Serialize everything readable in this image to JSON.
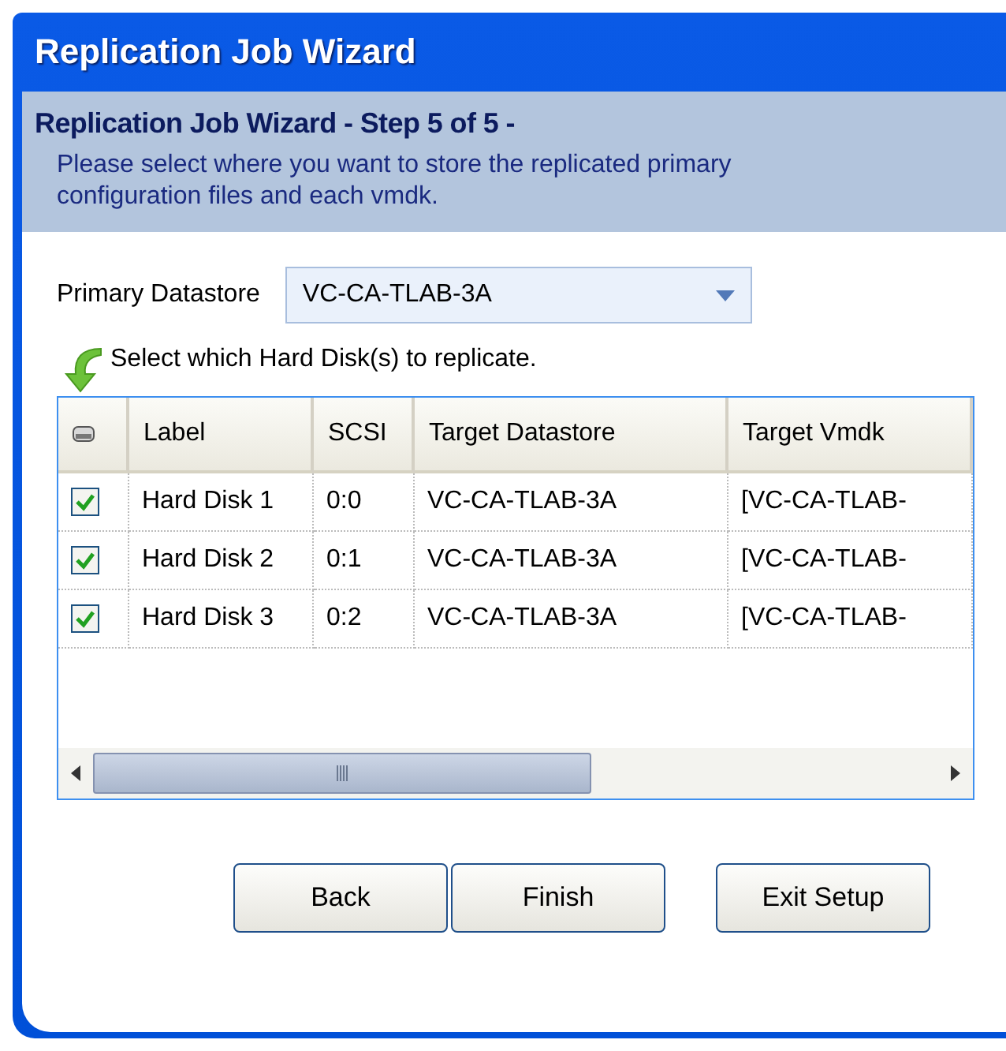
{
  "window": {
    "title": "Replication Job Wizard"
  },
  "header": {
    "title": "Replication Job Wizard - Step 5 of 5 -",
    "description": "Please select where you want to store the replicated primary configuration files and each vmdk."
  },
  "primary_datastore": {
    "label": "Primary Datastore",
    "value": "VC-CA-TLAB-3A"
  },
  "disk_hint": "Select which Hard Disk(s) to replicate.",
  "table": {
    "columns": [
      "Label",
      "SCSI",
      "Target Datastore",
      "Target Vmdk"
    ],
    "rows": [
      {
        "checked": true,
        "cells": [
          "Hard Disk 1",
          "0:0",
          "VC-CA-TLAB-3A",
          "[VC-CA-TLAB-"
        ]
      },
      {
        "checked": true,
        "cells": [
          "Hard Disk 2",
          "0:1",
          "VC-CA-TLAB-3A",
          "[VC-CA-TLAB-"
        ]
      },
      {
        "checked": true,
        "cells": [
          "Hard Disk 3",
          "0:2",
          "VC-CA-TLAB-3A",
          "[VC-CA-TLAB-"
        ]
      }
    ]
  },
  "buttons": [
    "Back",
    "Finish",
    "Exit Setup"
  ]
}
